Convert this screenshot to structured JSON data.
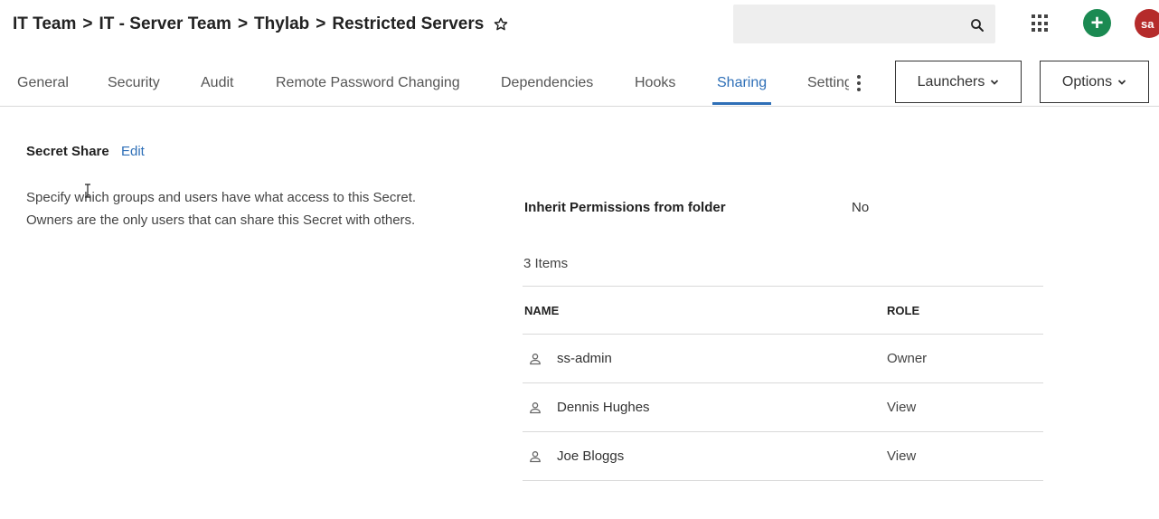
{
  "header": {
    "breadcrumb": [
      "IT Team",
      "IT - Server Team",
      "Thylab",
      "Restricted Servers"
    ],
    "separator": ">",
    "avatar_initials": "sa",
    "add_symbol": "+"
  },
  "tabs": [
    {
      "label": "General",
      "active": false
    },
    {
      "label": "Security",
      "active": false
    },
    {
      "label": "Audit",
      "active": false
    },
    {
      "label": "Remote Password Changing",
      "active": false
    },
    {
      "label": "Dependencies",
      "active": false
    },
    {
      "label": "Hooks",
      "active": false
    },
    {
      "label": "Sharing",
      "active": true
    },
    {
      "label": "Settings",
      "active": false
    }
  ],
  "buttons": {
    "launchers": "Launchers",
    "options": "Options"
  },
  "share": {
    "title": "Secret Share",
    "edit": "Edit",
    "description": "Specify which groups and users have what access to this Secret. Owners are the only users that can share this Secret with others.",
    "inherit_label": "Inherit Permissions from folder",
    "inherit_value": "No",
    "items_count": "3 Items"
  },
  "table": {
    "columns": [
      "NAME",
      "ROLE"
    ],
    "rows": [
      {
        "name": "ss-admin",
        "role": "Owner"
      },
      {
        "name": "Dennis Hughes",
        "role": "View"
      },
      {
        "name": "Joe Bloggs",
        "role": "View"
      }
    ]
  },
  "colors": {
    "accent": "#2e6fb7",
    "add_button": "#1b8a52",
    "avatar": "#b52b2b"
  },
  "icons": [
    "star-icon",
    "search-icon",
    "apps-grid-icon",
    "plus-icon",
    "kebab-menu-icon",
    "chevron-down-icon",
    "user-icon"
  ]
}
